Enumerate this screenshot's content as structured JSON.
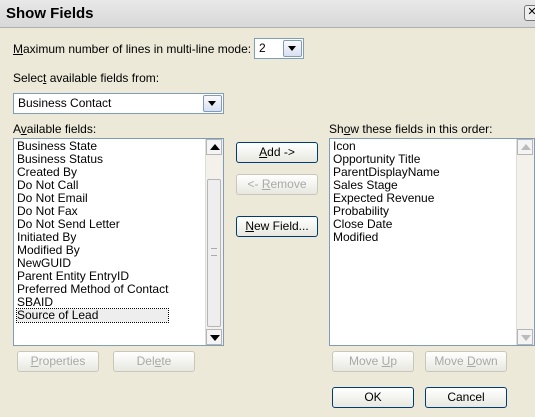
{
  "dialog": {
    "title": "Show Fields",
    "close_label": "✕"
  },
  "max_lines": {
    "label_prefix": "M",
    "label_rest": "aximum number of lines in multi-line mode:",
    "value": "2"
  },
  "select_from": {
    "label_prefix": "Selec",
    "label_ul": "t",
    "label_rest": " available fields from:",
    "value": "Business Contact"
  },
  "available": {
    "label_prefix": "A",
    "label_ul": "v",
    "label_rest": "ailable fields:",
    "items": [
      "Business State",
      "Business Status",
      "Created By",
      "Do Not Call",
      "Do Not Email",
      "Do Not Fax",
      "Do Not Send Letter",
      "Initiated By",
      "Modified By",
      "NewGUID",
      "Parent Entity EntryID",
      "Preferred Method of Contact",
      "SBAID",
      "Source of Lead"
    ],
    "selected": "Source of Lead"
  },
  "shown": {
    "label_prefix": "Sh",
    "label_ul": "o",
    "label_rest": "w these fields in this order:",
    "items": [
      "Icon",
      "Opportunity Title",
      "ParentDisplayName",
      "Sales Stage",
      "Expected Revenue",
      "Probability",
      "Close Date",
      "Modified"
    ]
  },
  "buttons": {
    "add": {
      "ul": "A",
      "rest": "dd ->"
    },
    "remove": {
      "pre": "<- ",
      "ul": "R",
      "rest": "emove"
    },
    "new_field": {
      "ul": "N",
      "rest": "ew Field..."
    },
    "properties": {
      "ul": "P",
      "rest": "roperties"
    },
    "delete": {
      "pre": "Del",
      "ul": "e",
      "rest": "te"
    },
    "move_up": {
      "pre": "Move ",
      "ul": "U",
      "rest": "p"
    },
    "move_down": {
      "pre": "Move ",
      "ul": "D",
      "rest": "own"
    },
    "ok": "OK",
    "cancel": "Cancel"
  }
}
